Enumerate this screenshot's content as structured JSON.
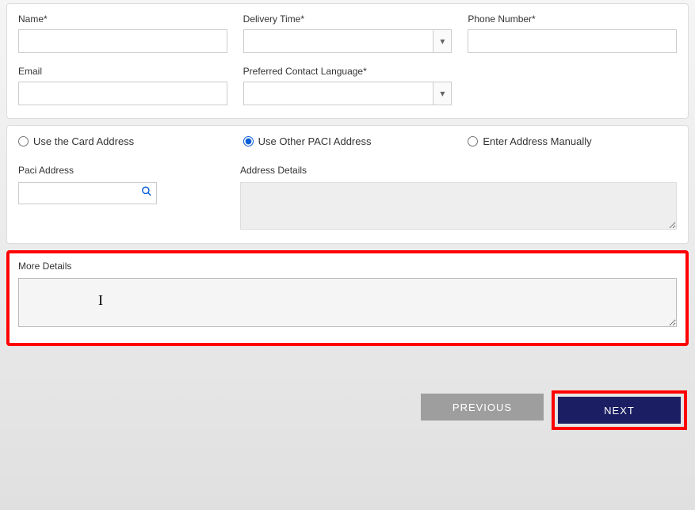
{
  "contact": {
    "name_label": "Name*",
    "delivery_time_label": "Delivery Time*",
    "phone_label": "Phone Number*",
    "email_label": "Email",
    "language_label": "Preferred Contact Language*"
  },
  "address": {
    "options": {
      "card": "Use the Card Address",
      "paci": "Use Other PACI Address",
      "manual": "Enter Address Manually"
    },
    "paci_label": "Paci Address",
    "details_label": "Address Details"
  },
  "more": {
    "label": "More Details"
  },
  "buttons": {
    "previous": "PREVIOUS",
    "next": "NEXT"
  }
}
